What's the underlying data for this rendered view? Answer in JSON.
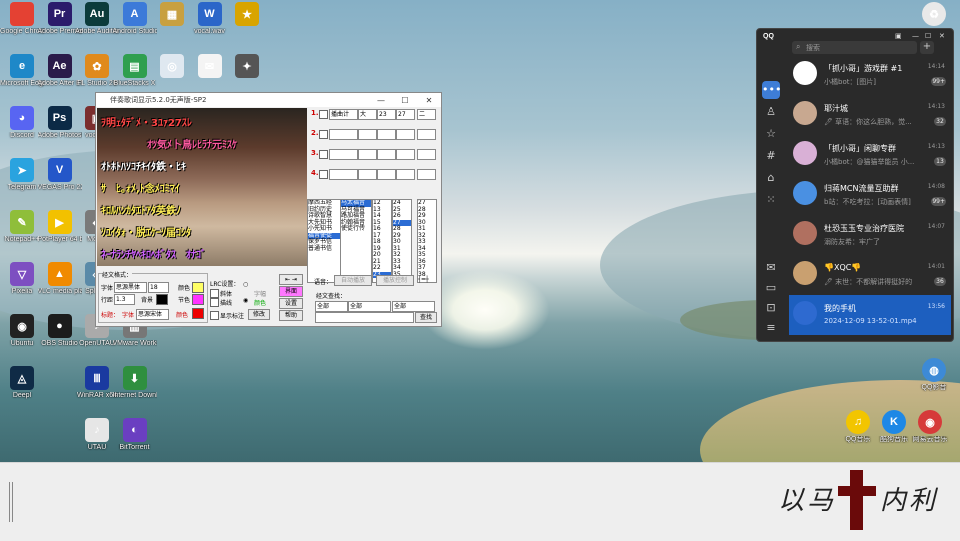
{
  "desktop": {
    "icons": [
      {
        "label": "Google Chrome",
        "glyph": "",
        "color": "#e44133",
        "x": 0,
        "y": 0
      },
      {
        "label": "Adobe Premiere...",
        "glyph": "Pr",
        "color": "#2b1b6b",
        "x": 1,
        "y": 0
      },
      {
        "label": "Adobe Audition...",
        "glyph": "Au",
        "color": "#0b3b3b",
        "x": 2,
        "y": 0
      },
      {
        "label": "Android Studio",
        "glyph": "A",
        "color": "#3c7ad9",
        "x": 3,
        "y": 0
      },
      {
        "label": "",
        "glyph": "▦",
        "color": "#c8a040",
        "x": 4,
        "y": 0
      },
      {
        "label": "vocal.wav",
        "glyph": "W",
        "color": "#2b66c9",
        "x": 5,
        "y": 0
      },
      {
        "label": "",
        "glyph": "★",
        "color": "#d8a400",
        "x": 6,
        "y": 0
      },
      {
        "label": "Microsoft Edge",
        "glyph": "e",
        "color": "#1e88c8",
        "x": 0,
        "y": 1
      },
      {
        "label": "Adobe After Effects 2024",
        "glyph": "Ae",
        "color": "#2a1b4a",
        "x": 1,
        "y": 1
      },
      {
        "label": "FL Studio 20",
        "glyph": "✿",
        "color": "#e08a1c",
        "x": 2,
        "y": 1
      },
      {
        "label": "BlueStacks X",
        "glyph": "▤",
        "color": "#2f9f4f",
        "x": 3,
        "y": 1
      },
      {
        "label": "",
        "glyph": "◎",
        "color": "#dfe8f0",
        "x": 4,
        "y": 1
      },
      {
        "label": "",
        "glyph": "✉",
        "color": "#f4f4f4",
        "x": 5,
        "y": 1
      },
      {
        "label": "",
        "glyph": "✦",
        "color": "#555555",
        "x": 6,
        "y": 1
      },
      {
        "label": "Discord",
        "glyph": "◕",
        "color": "#5865f2",
        "x": 0,
        "y": 2
      },
      {
        "label": "Adobe Photosho...",
        "glyph": "Ps",
        "color": "#0c2a46",
        "x": 1,
        "y": 2
      },
      {
        "label": "vocal.ai",
        "glyph": "▣",
        "color": "#7b2e2e",
        "x": 2,
        "y": 2
      },
      {
        "label": "Telegram",
        "glyph": "➤",
        "color": "#2aa3df",
        "x": 0,
        "y": 3
      },
      {
        "label": "VEGAS Pro 22",
        "glyph": "V",
        "color": "#2457c9",
        "x": 1,
        "y": 3
      },
      {
        "label": "Notepad++",
        "glyph": "✎",
        "color": "#8fbe3a",
        "x": 0,
        "y": 4
      },
      {
        "label": "PotPlayer 64 bit",
        "glyph": "▶",
        "color": "#f2c100",
        "x": 1,
        "y": 4
      },
      {
        "label": "Moe...",
        "glyph": "◆",
        "color": "#7a7a7a",
        "x": 2,
        "y": 4
      },
      {
        "label": "Pixelia",
        "glyph": "▽",
        "color": "#7d4fc1",
        "x": 0,
        "y": 5
      },
      {
        "label": "VLC media player",
        "glyph": "▲",
        "color": "#f08a00",
        "x": 1,
        "y": 5
      },
      {
        "label": "Splee...",
        "glyph": "◇",
        "color": "#5a8aa8",
        "x": 2,
        "y": 5
      },
      {
        "label": "Ubuntu",
        "glyph": "◉",
        "color": "#222222",
        "x": 0,
        "y": 6
      },
      {
        "label": "OBS Studio",
        "glyph": "●",
        "color": "#1c1c1c",
        "x": 1,
        "y": 6
      },
      {
        "label": "OpenUTAU",
        "glyph": "♪",
        "color": "#aaaaaa",
        "x": 2,
        "y": 6
      },
      {
        "label": "VMware Workstati...",
        "glyph": "▥",
        "color": "#777777",
        "x": 3,
        "y": 6
      },
      {
        "label": "Deepl",
        "glyph": "◬",
        "color": "#0f2b46",
        "x": 0,
        "y": 7
      },
      {
        "label": "WinRAR x64",
        "glyph": "Ⅲ",
        "color": "#1a3aa0",
        "x": 2,
        "y": 7
      },
      {
        "label": "Internet Downloa...",
        "glyph": "⬇",
        "color": "#2f8f3f",
        "x": 3,
        "y": 7
      },
      {
        "label": "UTAU",
        "glyph": "♪",
        "color": "#e6e6e6",
        "x": 2,
        "y": 8
      },
      {
        "label": "BitTorrent",
        "glyph": "◐",
        "color": "#6a3fc1",
        "x": 3,
        "y": 8
      }
    ],
    "right_icons": [
      {
        "label": "",
        "glyph": "♻",
        "color": "#e9e9e9"
      },
      {
        "label": "QQ影音",
        "glyph": "◍",
        "color": "#3d8ad6"
      },
      {
        "label": "QQ音乐",
        "glyph": "♫",
        "color": "#f2c500"
      },
      {
        "label": "酷狗音乐",
        "glyph": "K",
        "color": "#1e88e5"
      },
      {
        "label": "网易云音乐",
        "glyph": "◉",
        "color": "#d63a3a"
      }
    ],
    "signature_left": "以马",
    "signature_right": "内利"
  },
  "karaoke": {
    "title": "伴奏歌词显示5.2.0无声版-SP2",
    "lyrics": [
      {
        "text": "ｦ明ｪﾀﾃﾞﾒ・3ﾕｧ27ｽﾚ",
        "color": "#ff4646"
      },
      {
        "text": "　　ｵﾂ気ﾒ卜鳥ﾚﾋﾗﾅ元ﾐｽｹ",
        "color": "#ff5aa0"
      },
      {
        "text": "ｵﾄﾎﾄﾊｿｺﾁｷｲﾀ鉄・ﾋｷ",
        "color": "#ffffff"
      },
      {
        "text": "ｻ　ﾋ｡ｫﾒ,ﾄ念ﾒｺﾐﾏｲ",
        "color": "#ffee55"
      },
      {
        "text": "ｷﾛﾙﾊﾝｶﾀｴﾄｱﾀ英鉄ﾉ",
        "color": "#ffee55"
      },
      {
        "text": "ｿﾕｲﾀｫ・脱ｴｹｰｿ届ｺｼﾀ",
        "color": "#ffee55"
      },
      {
        "text": "ﾈｰﾅﾗﾝﾁﾔﾍｷﾛﾍﾎﾞﾀｽ　ｵﾅｺﾞ",
        "color": "#d060ff"
      }
    ],
    "slots": [
      {
        "num": "1.",
        "mode": "播曲计",
        "style": "大",
        "size": "23",
        "a": "27",
        "b": "二"
      },
      {
        "num": "2.",
        "mode": "",
        "style": "",
        "size": "",
        "a": "",
        "b": ""
      },
      {
        "num": "3.",
        "mode": "",
        "style": "",
        "size": "",
        "a": "",
        "b": ""
      },
      {
        "num": "4.",
        "mode": "",
        "style": "",
        "size": "",
        "a": "",
        "b": ""
      }
    ],
    "list1": [
      "摩西五经",
      "旧约历史",
      "诗歌智慧",
      "大先知书",
      "小先知书",
      "福音使徒",
      "保罗书信",
      "普通书信"
    ],
    "list2": [
      "马太福音",
      "马可福音",
      "路加福音",
      "约翰福音",
      "使徒行传"
    ],
    "list3": [
      "12",
      "13",
      "14",
      "15",
      "16",
      "17",
      "18",
      "19",
      "20",
      "21",
      "22",
      "23"
    ],
    "list4": [
      "24",
      "25",
      "26",
      "27",
      "28",
      "29",
      "30",
      "31",
      "32",
      "33",
      "34",
      "35"
    ],
    "list5": [
      "27",
      "28",
      "29",
      "30",
      "31",
      "32",
      "33",
      "34",
      "35",
      "36",
      "37",
      "38"
    ],
    "lyrics_fmt_title": "经文格式：",
    "font_label": "字体",
    "font_value": "思源黑体",
    "size_value": "18",
    "color_label": "颜色",
    "line_label": "行距",
    "line_value": "1.3",
    "bg_label": "背景",
    "section_label": "节色",
    "title_label": "标题：",
    "title_font_label": "字体",
    "title_font_value": "思源宋体",
    "title_color_label": "颜色",
    "lrc_title": "LRC设置：",
    "lrc_opt1": "斜体",
    "lrc_opt2": "描线",
    "lrc_r1": "字幅",
    "lrc_r2": "颜色",
    "show_label": "显示标注",
    "modify_btn": "修改",
    "btn_jiemian": "界面",
    "btn_shezhi": "设置",
    "btn_bangzhu": "帮助",
    "lang_label": "语音：",
    "auto_play": "自动播放",
    "play_ctl": "播放控制",
    "search_title": "经文查找：",
    "search_a": "全部",
    "search_b": "全部",
    "search_c": "全部",
    "search_btn": "查找"
  },
  "qq": {
    "logo": "QQ",
    "search_placeholder": "搜索",
    "conversations": [
      {
        "name": "「抓小哥」游戏群 #1",
        "msg": "小橘bot：[图片]",
        "time": "14:14",
        "badge": "99+",
        "avatar": "#ffffff",
        "active": false
      },
      {
        "name": "耶汁城",
        "msg": "🖊 草语：你这么胆熟，觉...",
        "time": "14:13",
        "badge": "32",
        "avatar": "#c8a890",
        "active": false
      },
      {
        "name": "「抓小哥」闲聊专群",
        "msg": "小橘bot：@猫猫举能员 小...",
        "time": "14:13",
        "badge": "13",
        "avatar": "#d9b0d6",
        "active": false
      },
      {
        "name": "归蒋MCN流量互助群",
        "msg": "b站：不吃考拉：[动画表情]",
        "time": "14:08",
        "badge": "99+",
        "avatar": "#4a90e2",
        "active": false
      },
      {
        "name": "杜恐玉玉专业治疗医院",
        "msg": "溺防友希：牢广了",
        "time": "14:07",
        "badge": "",
        "avatar": "#b07060",
        "active": false
      },
      {
        "name": "👎XQC👎",
        "msg": "🖊 末世：不都解讲得挺好的",
        "time": "14:01",
        "badge": "36",
        "avatar": "#c9a070",
        "active": false
      },
      {
        "name": "我的手机",
        "msg": "2024-12-09 13-52-01.mp4",
        "time": "13:56",
        "badge": "",
        "avatar": "#2e6ad0",
        "active": true
      }
    ]
  }
}
